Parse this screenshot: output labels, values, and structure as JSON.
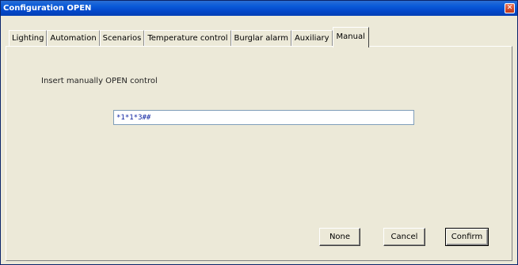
{
  "window": {
    "title": "Configuration OPEN",
    "close_glyph": "✕"
  },
  "tabs": [
    {
      "label": "Lighting",
      "active": false
    },
    {
      "label": "Automation",
      "active": false
    },
    {
      "label": "Scenarios",
      "active": false
    },
    {
      "label": "Temperature control",
      "active": false
    },
    {
      "label": "Burglar alarm",
      "active": false
    },
    {
      "label": "Auxiliary",
      "active": false
    },
    {
      "label": "Manual",
      "active": true
    }
  ],
  "manual": {
    "prompt_label": "Insert manually OPEN control",
    "command_value": "*1*1*3##"
  },
  "buttons": {
    "none_label": "None",
    "cancel_label": "Cancel",
    "confirm_label": "Confirm"
  },
  "colors": {
    "titlebar": "#0a5ad8",
    "input_text": "#0a1fa0",
    "dialog_bg": "#ece9d8"
  }
}
